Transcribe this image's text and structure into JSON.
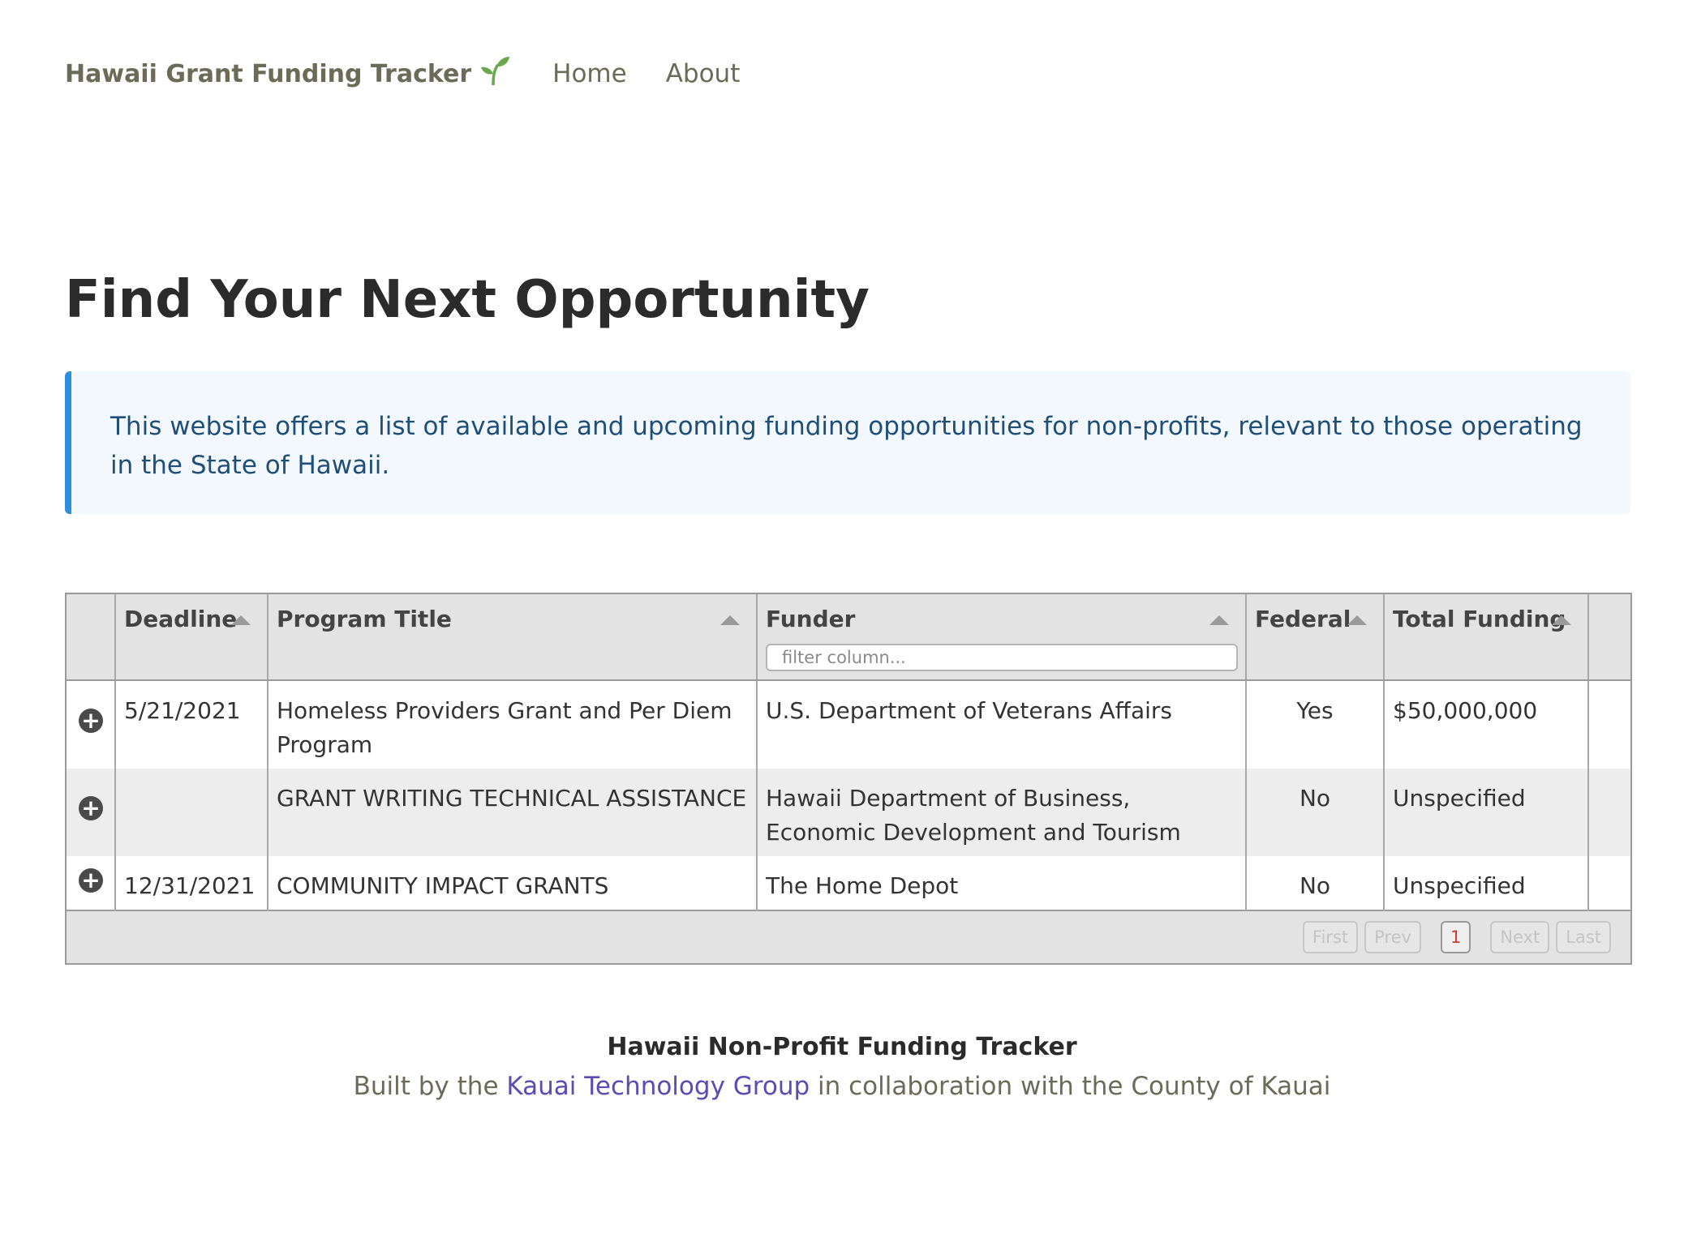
{
  "header": {
    "brand": "Hawaii Grant Funding Tracker",
    "brand_icon": "seedling-icon",
    "nav": [
      {
        "label": "Home"
      },
      {
        "label": "About"
      }
    ]
  },
  "main": {
    "title": "Find Your Next Opportunity",
    "callout": "This website offers a list of available and upcoming funding opportunities for non-profits, relevant to those operating in the State of Hawaii."
  },
  "table": {
    "columns": [
      "Deadline",
      "Program Title",
      "Funder",
      "Federal",
      "Total Funding"
    ],
    "filter_placeholder": "filter column...",
    "rows": [
      {
        "deadline": "5/21/2021",
        "title": "Homeless Providers Grant and Per Diem Program",
        "funder": "U.S. Department of Veterans Affairs",
        "federal": "Yes",
        "funding": "$50,000,000"
      },
      {
        "deadline": "",
        "title": "GRANT WRITING TECHNICAL ASSISTANCE",
        "funder": "Hawaii Department of Business, Economic Development and Tourism",
        "federal": "No",
        "funding": "Unspecified"
      },
      {
        "deadline": "12/31/2021",
        "title": "COMMUNITY IMPACT GRANTS",
        "funder": "The Home Depot",
        "federal": "No",
        "funding": "Unspecified"
      }
    ],
    "pager": {
      "first": "First",
      "prev": "Prev",
      "current": "1",
      "next": "Next",
      "last": "Last"
    }
  },
  "footer": {
    "title": "Hawaii Non-Profit Funding Tracker",
    "prefix": "Built by the",
    "link": "Kauai Technology Group",
    "suffix": "in collaboration with the County of Kauai"
  },
  "colors": {
    "accent": "#2f8ddf",
    "callout_bg": "#f2f8fd",
    "link": "#5c4bb5",
    "pager_current": "#d23c2f"
  }
}
